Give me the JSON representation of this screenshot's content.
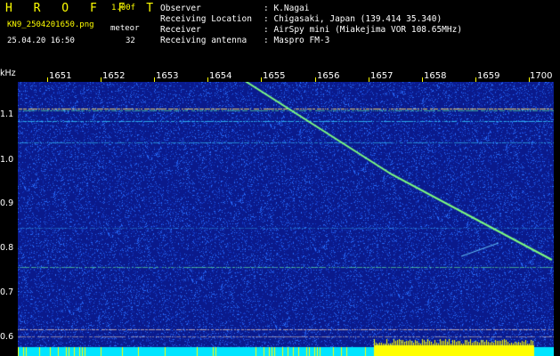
{
  "header": {
    "app_title": "H R O F F T",
    "version": "1.00f",
    "filename": "KN9_2504201650.png",
    "meteor_label": "meteor",
    "timestamp": "25.04.20 16:50",
    "count": "32",
    "observer_label": "Observer",
    "observer_value": ": K.Nagai",
    "location_label": "Receiving Location",
    "location_value": ": Chigasaki, Japan (139.414 35.340)",
    "receiver_label": "Receiver",
    "receiver_value": ": AirSpy mini (Miakejima VOR 108.65MHz)",
    "antenna_label": "Receiving antenna",
    "antenna_value": ": Maspro FM-3"
  },
  "axis": {
    "freq_unit": "kHz",
    "time_ticks": [
      "1651",
      "1652",
      "1653",
      "1654",
      "1655",
      "1656",
      "1657",
      "1658",
      "1659",
      "1700"
    ],
    "freq_ticks": [
      "1.1",
      "1.0",
      "0.9",
      "0.8",
      "0.7",
      "0.6"
    ]
  },
  "colors": {
    "background": "#0a1a8c",
    "noise": "#3a6cff",
    "trace": "#7fff7f",
    "bar_cyan": "#00e5ff",
    "bar_yellow": "#ffff00"
  }
}
